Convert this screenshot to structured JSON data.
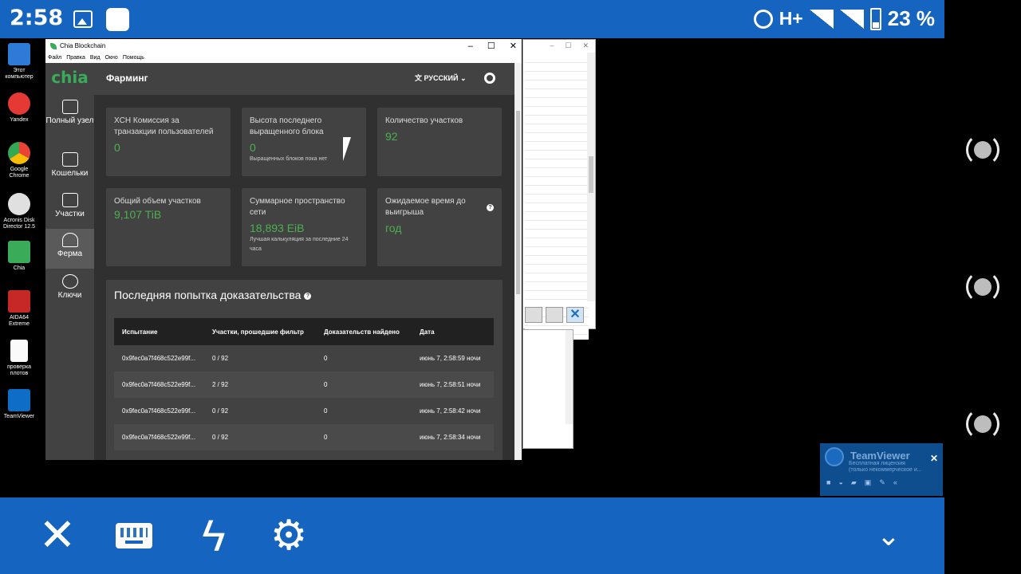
{
  "status_bar": {
    "time": "2:58",
    "network": "H+",
    "battery": "23 %"
  },
  "desktop_icons": [
    {
      "label": "Этот компьютер"
    },
    {
      "label": "Yandex"
    },
    {
      "label": "Google Chrome"
    },
    {
      "label": "Acronis Disk Director 12.5"
    },
    {
      "label": "Chia"
    },
    {
      "label": "AIDA64 Extreme"
    },
    {
      "label": "проверка плотов"
    },
    {
      "label": "TeamViewer"
    }
  ],
  "window": {
    "title": "Chia Blockchain",
    "menu": [
      "Файл",
      "Правка",
      "Вид",
      "Окно",
      "Помощь"
    ],
    "controls": {
      "minimize": "–",
      "maximize": "☐",
      "close": "✕"
    }
  },
  "app": {
    "logo": "chia",
    "page_title": "Фарминг",
    "language": "РУССКИЙ",
    "nav": [
      {
        "label": "Полный узел"
      },
      {
        "label": "Кошельки"
      },
      {
        "label": "Участки"
      },
      {
        "label": "Ферма",
        "active": true
      },
      {
        "label": "Ключи"
      }
    ],
    "cards": [
      {
        "title": "XCH Комиссия за транзакции пользователей",
        "value": "0",
        "note": ""
      },
      {
        "title": "Высота последнего выращенного блока",
        "value": "0",
        "note": "Выращенных блоков пока нет"
      },
      {
        "title": "Количество участков",
        "value": "92",
        "note": ""
      },
      {
        "title": "Общий объем участков",
        "value": "9,107 TiB",
        "note": ""
      },
      {
        "title": "Суммарное пространство сети",
        "value": "18,893 EiB",
        "note": "Лучшая калькуляция за последние 24 часа"
      },
      {
        "title": "Ожидаемое время до выигрыша",
        "value": "год",
        "note": ""
      }
    ],
    "proof": {
      "title": "Последняя попытка доказательства",
      "columns": [
        "Испытание",
        "Участки, прошедшие фильтр",
        "Доказательств найдено",
        "Дата"
      ],
      "rows": [
        [
          "0x9fec0a7f468c522e99f...",
          "0 / 92",
          "0",
          "июнь 7, 2:58:59 ночи"
        ],
        [
          "0x9fec0a7f468c522e99f...",
          "2 / 92",
          "0",
          "июнь 7, 2:58:51 ночи"
        ],
        [
          "0x9fec0a7f468c522e99f...",
          "0 / 92",
          "0",
          "июнь 7, 2:58:42 ночи"
        ],
        [
          "0x9fec0a7f468c522e99f...",
          "0 / 92",
          "0",
          "июнь 7, 2:58:34 ночи"
        ]
      ]
    }
  },
  "teamviewer_popup": {
    "name": "TeamViewer",
    "line1": "Бесплатная лицензия",
    "line2": "(только некоммерческое и...",
    "close": "✕"
  },
  "bottom_bar": {
    "close": "✕",
    "flash": "ϟ",
    "gear": "⚙",
    "chevron": "⌄"
  },
  "colors": {
    "android_blue": "#1565c0",
    "chia_green": "#3aac59",
    "value_green": "#4caf50",
    "app_bg": "#303030",
    "card_bg": "#424242"
  }
}
